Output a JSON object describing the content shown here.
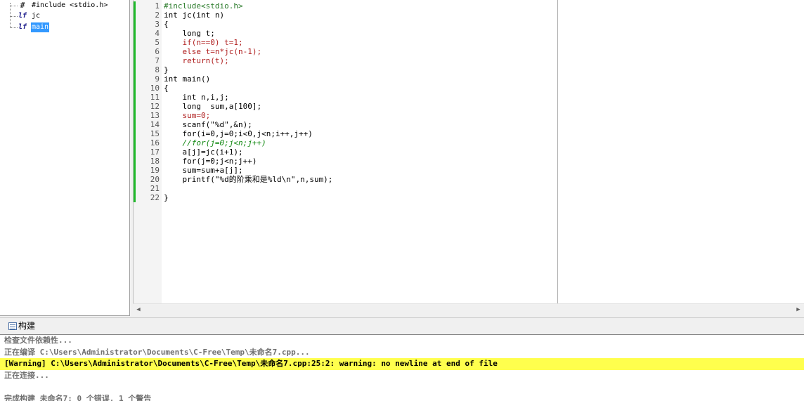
{
  "symbol_tree": {
    "items": [
      {
        "label": "#include <stdio.h>",
        "icon": "hash-include-icon",
        "selected": false
      },
      {
        "label": "jc",
        "icon": "function-icon",
        "selected": false
      },
      {
        "label": "main",
        "icon": "function-icon",
        "selected": true
      }
    ]
  },
  "editor": {
    "line_numbers": [
      "1",
      "2",
      "3",
      "4",
      "5",
      "6",
      "7",
      "8",
      "9",
      "10",
      "11",
      "12",
      "13",
      "14",
      "15",
      "16",
      "17",
      "18",
      "19",
      "20",
      "21",
      "22"
    ],
    "lines": [
      {
        "text": "#include<stdio.h>",
        "style": "c-dir"
      },
      {
        "text": "int jc(int n)",
        "style": ""
      },
      {
        "text": "{",
        "style": ""
      },
      {
        "text": "    long t;",
        "style": ""
      },
      {
        "text": "    if(n==0) t=1;",
        "style": "c-body"
      },
      {
        "text": "    else t=n*jc(n-1);",
        "style": "c-body"
      },
      {
        "text": "    return(t);",
        "style": "c-body"
      },
      {
        "text": "}",
        "style": ""
      },
      {
        "text": "int main()",
        "style": ""
      },
      {
        "text": "{",
        "style": ""
      },
      {
        "text": "    int n,i,j;",
        "style": ""
      },
      {
        "text": "    long  sum,a[100];",
        "style": ""
      },
      {
        "text": "    sum=0;",
        "style": "c-body"
      },
      {
        "text": "    scanf(\"%d\",&n);",
        "style": ""
      },
      {
        "text": "    for(i=0,j=0;i<0,j<n;i++,j++)",
        "style": ""
      },
      {
        "text": "    //for(j=0;j<n;j++)",
        "style": "c-com"
      },
      {
        "text": "    a[j]=jc(i+1);",
        "style": ""
      },
      {
        "text": "    for(j=0;j<n;j++)",
        "style": ""
      },
      {
        "text": "    sum=sum+a[j];",
        "style": ""
      },
      {
        "text": "    printf(\"%d的阶乘和是%ld\\n\",n,sum);",
        "style": ""
      },
      {
        "text": "",
        "style": ""
      },
      {
        "text": "}",
        "style": ""
      }
    ],
    "change_marker_color": "#1fba2a"
  },
  "build_panel": {
    "tab_label": "构建",
    "tab_icon": "build-output-icon",
    "output": [
      {
        "text": "检查文件依赖性...",
        "type": "info"
      },
      {
        "text": "正在编译 C:\\Users\\Administrator\\Documents\\C-Free\\Temp\\未命名7.cpp...",
        "type": "info"
      },
      {
        "text": "[Warning] C:\\Users\\Administrator\\Documents\\C-Free\\Temp\\未命名7.cpp:25:2: warning: no newline at end of file",
        "type": "warning"
      },
      {
        "text": "正在连接...",
        "type": "info"
      },
      {
        "text": "",
        "type": "info"
      },
      {
        "text": "完成构建 未命名7: 0 个错误, 1 个警告",
        "type": "info"
      }
    ],
    "warning_highlight_color": "#ffff4d"
  }
}
